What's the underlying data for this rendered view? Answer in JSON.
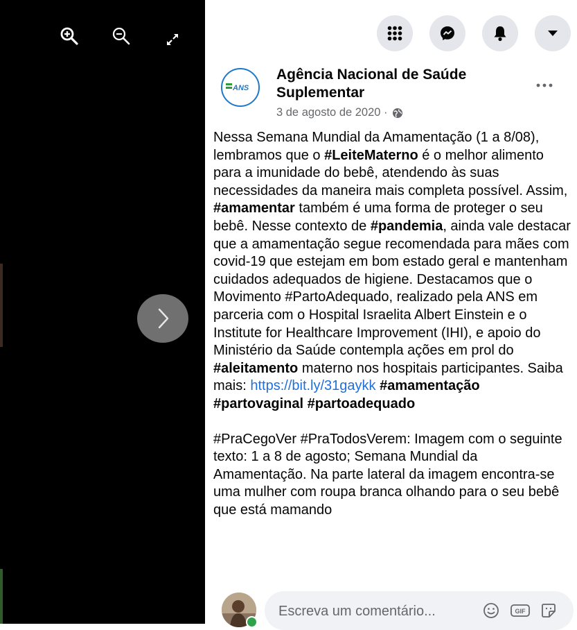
{
  "viewer": {
    "zoom_in_icon": "zoom-in-icon",
    "zoom_out_icon": "zoom-out-icon",
    "fullscreen_icon": "expand-icon",
    "next_icon": "chevron-right-icon"
  },
  "topbar": {
    "menu_icon": "grid-menu-icon",
    "messenger_icon": "messenger-icon",
    "notifications_icon": "bell-icon",
    "account_icon": "caret-down-icon"
  },
  "post": {
    "page_name": "Agência Nacional de Saúde Suplementar",
    "avatar_text": "ANS",
    "date": "3 de agosto de 2020 ·",
    "privacy_icon": "globe-icon",
    "body": [
      [
        {
          "t": "Nessa Semana Mundial da Amamentação (1 a 8/08), lembramos que o "
        },
        {
          "t": "#LeiteMaterno",
          "tag": true
        },
        {
          "t": " é o melhor alimento para a imunidade do bebê, atendendo às suas necessidades da maneira mais completa possível. Assim, "
        },
        {
          "t": "#amamentar",
          "tag": true
        },
        {
          "t": " também é uma forma de proteger o seu bebê. Nesse contexto de "
        },
        {
          "t": "#pandemia",
          "tag": true
        },
        {
          "t": ", ainda vale destacar que a amamentação segue recomendada para mães com covid-19 que estejam em bom estado geral e mantenham cuidados adequados de higiene. Destacamos que o Movimento #PartoAdequado, realizado pela ANS em parceria com o Hospital Israelita Albert Einstein e o Institute for Healthcare Improvement (IHI), e apoio do Ministério da Saúde contempla ações em prol do "
        },
        {
          "t": "#aleitamento",
          "tag": true
        },
        {
          "t": " materno nos hospitais participantes. Saiba mais: "
        },
        {
          "t": "https://bit.ly/31gaykk",
          "link": true
        },
        {
          "t": " "
        },
        {
          "t": "#amamentação #partovaginal #partoadequado",
          "tag": true
        }
      ],
      [
        {
          "t": "#PraCegoVer #PraTodosVerem"
        },
        {
          "t": ": Imagem com o seguinte texto: 1 a 8 de agosto; Semana Mundial da Amamentação. Na parte lateral da imagem encontra-se uma mulher com roupa branca olhando para o seu bebê que está mamando"
        }
      ]
    ]
  },
  "comment": {
    "placeholder": "Escreva um comentário...",
    "emoji_icon": "smiley-icon",
    "gif_label": "GIF",
    "sticker_icon": "sticker-icon"
  }
}
